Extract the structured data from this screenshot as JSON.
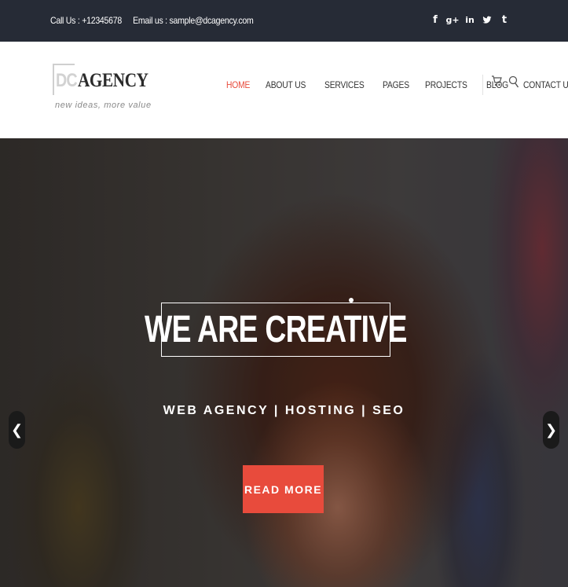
{
  "topbar": {
    "phone": "Call Us : +12345678",
    "email": "Email us : sample@dcagency.com",
    "social": [
      {
        "icon": "facebook-icon",
        "glyph": "f"
      },
      {
        "icon": "google-plus-icon",
        "glyph": "g+"
      },
      {
        "icon": "linkedin-icon",
        "glyph": "in"
      },
      {
        "icon": "twitter-icon",
        "glyph": "t"
      },
      {
        "icon": "tumblr-icon",
        "glyph": "t"
      }
    ]
  },
  "logo": {
    "dc": "DC",
    "agency": "AGENCY",
    "tagline": "new ideas, more value"
  },
  "nav": {
    "items": [
      {
        "label": "HOME",
        "active": true
      },
      {
        "label": "ABOUT US",
        "active": false
      },
      {
        "label": "SERVICES",
        "active": false
      },
      {
        "label": "PAGES",
        "active": false
      },
      {
        "label": "PROJECTS",
        "active": false
      },
      {
        "label": "BLOG",
        "active": false
      },
      {
        "label": "CONTACT US",
        "active": false
      }
    ],
    "active_color": "#e84b3c"
  },
  "hero": {
    "title": "WE ARE CREATIVE",
    "subtitle": "WEB AGENCY | HOSTING | SEO",
    "button": "READ MORE",
    "prev": "❮",
    "next": "❯",
    "button_color": "#e84b3c"
  }
}
